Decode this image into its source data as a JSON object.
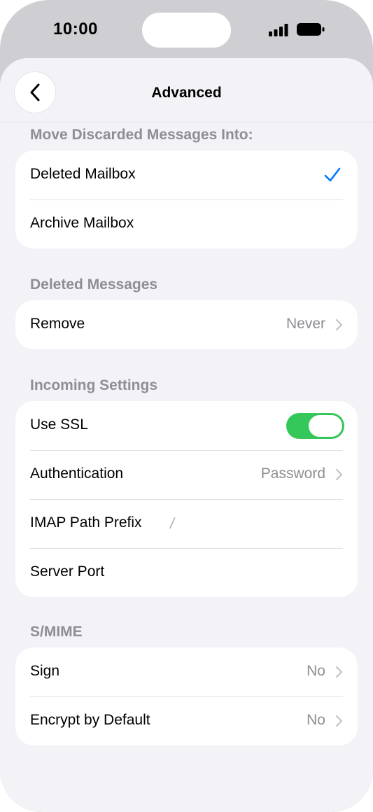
{
  "status_bar": {
    "time": "10:00"
  },
  "nav": {
    "title": "Advanced"
  },
  "sections": {
    "discarded": {
      "header": "Move Discarded Messages Into:",
      "deleted_mailbox": "Deleted Mailbox",
      "archive_mailbox": "Archive Mailbox",
      "selected": "Deleted Mailbox"
    },
    "deleted_messages": {
      "header": "Deleted Messages",
      "remove_label": "Remove",
      "remove_value": "Never"
    },
    "incoming": {
      "header": "Incoming Settings",
      "ssl_label": "Use SSL",
      "ssl_on": true,
      "auth_label": "Authentication",
      "auth_value": "Password",
      "prefix_label": "IMAP Path Prefix",
      "prefix_value": "/",
      "port_label": "Server Port"
    },
    "smime": {
      "header": "S/MIME",
      "sign_label": "Sign",
      "sign_value": "No",
      "encrypt_label": "Encrypt by Default",
      "encrypt_value": "No"
    }
  },
  "colors": {
    "accent": "#007aff",
    "toggle_on": "#34c759",
    "secondary_text": "#8e8e93"
  }
}
